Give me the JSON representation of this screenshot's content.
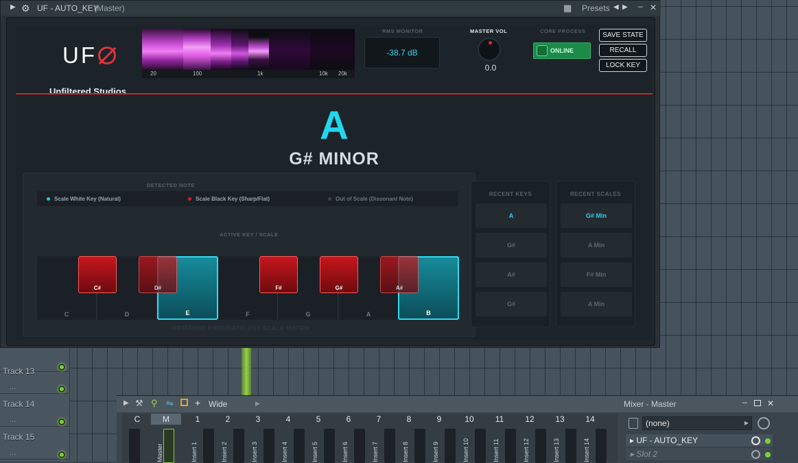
{
  "window": {
    "title": "UF - AUTO_KEY",
    "title_suffix": "(Master)",
    "presets_label": "Presets",
    "minimize": "–",
    "close": "✕"
  },
  "brand": {
    "logo_text": "UF",
    "company": "Unfiltered Studios"
  },
  "spectrum": {
    "axis_ticks": [
      "20",
      "100",
      "1k",
      "10k",
      "20k"
    ]
  },
  "rms": {
    "label": "RMS MONITOR",
    "value": "-38.7 dB"
  },
  "master_vol": {
    "label": "MASTER VOL",
    "value": "0.0"
  },
  "core": {
    "label": "CORE PROCESS",
    "status": "ONLINE"
  },
  "buttons": {
    "save": "SAVE STATE",
    "recall": "RECALL",
    "lock": "LOCK KEY"
  },
  "detected": {
    "key": "A",
    "scale": "G# MINOR"
  },
  "keyboard_panel": {
    "detected_label": "DETECTED NOTE",
    "legend": [
      {
        "text": "Scale White Key (Natural)",
        "color": "#22c9e4"
      },
      {
        "text": "Scale Black Key (Sharp/Flat)",
        "color": "#d81e25"
      },
      {
        "text": "Out of Scale (Dissonant Note)",
        "color": "#3a434b"
      }
    ],
    "active_label": "ACTIVE KEY / SCALE",
    "matrix_label": "METATUNE CHROMATIC KEY SCALE MATRIX",
    "white_keys": [
      "C",
      "D",
      "E",
      "F",
      "G",
      "A",
      "B"
    ],
    "black_keys": [
      "C#",
      "D#",
      "F#",
      "G#",
      "A#"
    ]
  },
  "recent_keys": {
    "label": "RECENT KEYS",
    "items": [
      "A",
      "G#",
      "A#",
      "G#"
    ]
  },
  "recent_scales": {
    "label": "RECENT SCALES",
    "items": [
      "G# Min",
      "A Min",
      "F# Min",
      "A Min"
    ]
  },
  "tracks": [
    "Track 13",
    "Track 14",
    "Track 15"
  ],
  "track_dots": "...",
  "mixer": {
    "wide_label": "Wide",
    "title": "Mixer - Master",
    "route": "(none)",
    "heads": [
      "C",
      "M",
      "1",
      "2",
      "3",
      "4",
      "5",
      "6",
      "7",
      "8",
      "9",
      "10",
      "11",
      "12",
      "13",
      "14"
    ],
    "strip_labels": [
      "Master",
      "Insert 1",
      "Insert 2",
      "Insert 3",
      "Insert 4",
      "Insert 5",
      "Insert 6",
      "Insert 7",
      "Insert 8",
      "Insert 9",
      "Insert 10",
      "Insert 11",
      "Insert 12",
      "Insert 13",
      "Insert 14"
    ],
    "slots": [
      "UF - AUTO_KEY",
      "Slot 2"
    ]
  }
}
